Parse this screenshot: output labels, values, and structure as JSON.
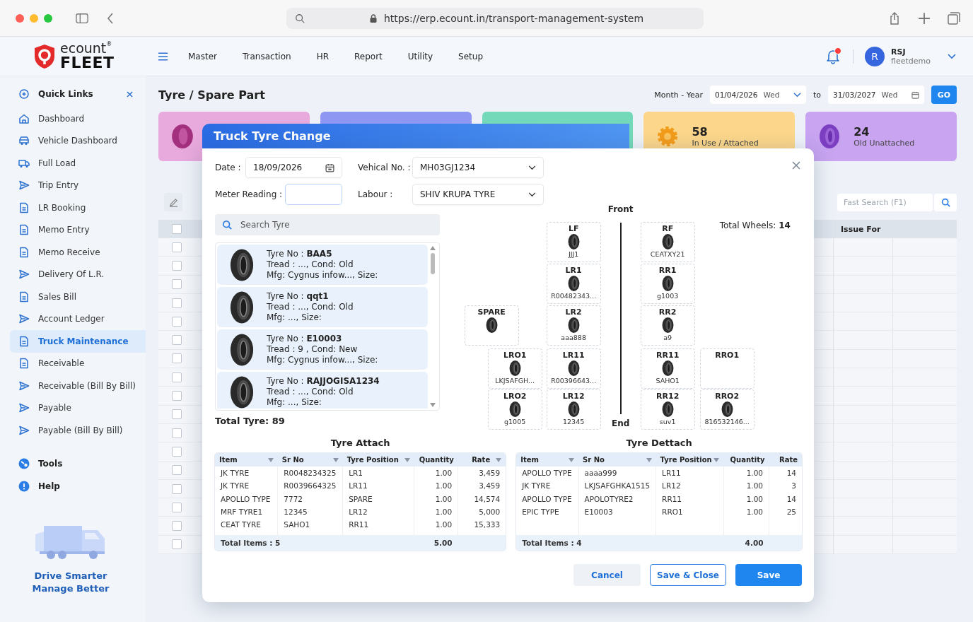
{
  "browser": {
    "url": "https://erp.ecount.in/transport-management-system"
  },
  "app": {
    "logo_top": "ecount",
    "logo_mark": "®",
    "logo_bottom": "FLEET"
  },
  "menu": [
    {
      "label": "Master"
    },
    {
      "label": "Transaction"
    },
    {
      "label": "HR"
    },
    {
      "label": "Report"
    },
    {
      "label": "Utility"
    },
    {
      "label": "Setup"
    }
  ],
  "notifications": {
    "unread": true
  },
  "user": {
    "initial": "R",
    "name": "RSJ",
    "account": "fleetdemo"
  },
  "sidebar": {
    "title": "Quick Links",
    "items": [
      {
        "label": "Dashboard",
        "selected": false
      },
      {
        "label": "Vehicle Dashboard",
        "selected": false
      },
      {
        "label": "Full Load",
        "selected": false
      },
      {
        "label": "Trip Entry",
        "selected": false
      },
      {
        "label": "LR Booking",
        "selected": false
      },
      {
        "label": "Memo Entry",
        "selected": false
      },
      {
        "label": "Memo Receive",
        "selected": false
      },
      {
        "label": "Delivery Of L.R.",
        "selected": false
      },
      {
        "label": "Sales Bill",
        "selected": false
      },
      {
        "label": "Account Ledger",
        "selected": false
      },
      {
        "label": "Truck Maintenance",
        "selected": true
      },
      {
        "label": "Receivable",
        "selected": false
      },
      {
        "label": "Receivable (Bill By Bill)",
        "selected": false
      },
      {
        "label": "Payable",
        "selected": false
      },
      {
        "label": "Payable (Bill By Bill)",
        "selected": false
      }
    ],
    "extras": [
      {
        "label": "Tools"
      },
      {
        "label": "Help"
      }
    ],
    "tagline": [
      "Drive Smarter",
      "Manage Better"
    ]
  },
  "page": {
    "title": "Tyre / Spare Part",
    "period_label": "Month - Year",
    "from_date": "01/04/2026",
    "from_day": "Wed",
    "to_label": "to",
    "to_date": "31/03/2027",
    "to_day": "Wed",
    "go": "GO"
  },
  "stat_cards": [
    {
      "color": "#e8a9dc"
    },
    {
      "color": "#8e97f1"
    },
    {
      "color": "#74d9b8"
    },
    {
      "color": "#fbd68b",
      "count": "58",
      "label": "In Use / Attached"
    },
    {
      "color": "#c8a4f1",
      "count": "24",
      "label": "Old Unattached"
    }
  ],
  "list": {
    "search_placeholder": "Fast Search (F1)",
    "column_3": "Issue For",
    "select_all": {
      "checked": false
    },
    "rows": [
      {
        "checked": false
      },
      {
        "checked": false
      },
      {
        "checked": false
      },
      {
        "checked": false
      },
      {
        "checked": false
      },
      {
        "checked": false
      },
      {
        "checked": false
      },
      {
        "checked": false
      },
      {
        "checked": false
      },
      {
        "checked": false
      },
      {
        "checked": false
      },
      {
        "checked": false
      },
      {
        "checked": false
      },
      {
        "checked": false
      },
      {
        "checked": false
      },
      {
        "checked": false
      },
      {
        "checked": false
      }
    ]
  },
  "modal": {
    "title": "Truck Tyre Change",
    "date_label": "Date :",
    "date": "18/09/2026",
    "vehicle_label": "Vehical No. :",
    "vehicle": "MH03GJ1234",
    "meter_label": "Meter Reading :",
    "labour_label": "Labour :",
    "labour": "SHIV KRUPA TYRE",
    "search_placeholder": "Search Tyre",
    "tyres": [
      {
        "title": "Tyre No : **BAA5**",
        "tread": "Tread : ..., Cond: Old",
        "mfg": "Mfg: Cygnus infow..., Size:"
      },
      {
        "title": "Tyre No : **qqt1**",
        "tread": "Tread : ..., Cond: Old",
        "mfg": "Mfg: ..., Size:"
      },
      {
        "title": "Tyre No : **E10003**",
        "tread": "Tread : 9 , Cond: New",
        "mfg": "Mfg: Cygnus infow..., Size:"
      },
      {
        "title": "Tyre No : **RAJJOGISA1234**",
        "tread": "Tread : ..., Cond: Old",
        "mfg": "Mfg: ..., Size:"
      }
    ],
    "total_tyre": "Total Tyre: 89",
    "diagram": {
      "front": "Front",
      "end": "End",
      "total_wheels": "Total Wheels: **14**",
      "wheels": [
        {
          "position": "LF",
          "mounted": true,
          "tyre_no": "JJJ1"
        },
        {
          "position": "RF",
          "mounted": true,
          "tyre_no": "CEATXY21"
        },
        {
          "position": "LR1",
          "mounted": true,
          "tyre_no": "R00482343..."
        },
        {
          "position": "RR1",
          "mounted": true,
          "tyre_no": "g1003"
        },
        {
          "position": "SPARE",
          "mounted": true
        },
        {
          "position": "LR2",
          "mounted": true,
          "tyre_no": "aaa888"
        },
        {
          "position": "RR2",
          "mounted": true,
          "tyre_no": "a9"
        },
        {
          "position": "LRO1",
          "mounted": true,
          "tyre_no": "LKJSAFGH..."
        },
        {
          "position": "LR11",
          "mounted": true,
          "tyre_no": "R00396643..."
        },
        {
          "position": "RR11",
          "mounted": true,
          "tyre_no": "SAHO1"
        },
        {
          "position": "RRO1",
          "mounted": false
        },
        {
          "position": "LRO2",
          "mounted": true,
          "tyre_no": "g1005"
        },
        {
          "position": "LR12",
          "mounted": true,
          "tyre_no": "12345"
        },
        {
          "position": "RR12",
          "mounted": true,
          "tyre_no": "suv1"
        },
        {
          "position": "RRO2",
          "mounted": true,
          "tyre_no": "816532146..."
        }
      ]
    },
    "attach": {
      "title": "Tyre Attach",
      "columns": [
        {
          "label": "Item",
          "filter": true
        },
        {
          "label": "Sr No",
          "filter": true
        },
        {
          "label": "Tyre Position",
          "filter": true
        },
        {
          "label": "Quantity",
          "filter": false
        },
        {
          "label": "Rate",
          "filter": true
        }
      ],
      "rows": [
        [
          "JK TYRE",
          "R0048234325",
          "LR1",
          "1.00",
          "3,459"
        ],
        [
          "JK TYRE",
          "R0039664325",
          "LR11",
          "1.00",
          "3,459"
        ],
        [
          "APOLLO TYPE",
          "7772",
          "SPARE",
          "1.00",
          "14,574"
        ],
        [
          "MRF TYRE1",
          "12345",
          "LR12",
          "1.00",
          "5,000"
        ],
        [
          "CEAT TYRE",
          "SAHO1",
          "RR11",
          "1.00",
          "15,333"
        ]
      ],
      "footer_label": "Total Items : 5",
      "footer_quantity": "5.00"
    },
    "detach": {
      "title": "Tyre Dettach",
      "columns": [
        {
          "label": "Item",
          "filter": true
        },
        {
          "label": "Sr No",
          "filter": true
        },
        {
          "label": "Tyre Position",
          "filter": true
        },
        {
          "label": "Quantity",
          "filter": false
        },
        {
          "label": "Rate",
          "filter": false
        }
      ],
      "rows": [
        [
          "APOLLO TYPE",
          "aaaa999",
          "LR11",
          "1.00",
          "14"
        ],
        [
          "JK TYRE",
          "LKJSAFGHKA1515",
          "LR12",
          "1.00",
          "3"
        ],
        [
          "APOLLO TYPE",
          "APOLOTYRE2",
          "RR11",
          "1.00",
          "14"
        ],
        [
          "EPIC TYPE",
          "E10003",
          "RRO1",
          "1.00",
          "25"
        ]
      ],
      "footer_label": "Total Items : 4",
      "footer_quantity": "4.00"
    },
    "buttons": [
      {
        "label": "Cancel",
        "kind": "secondary"
      },
      {
        "label": "Save & Close",
        "kind": "outline"
      },
      {
        "label": "Save",
        "kind": "primary"
      }
    ]
  }
}
